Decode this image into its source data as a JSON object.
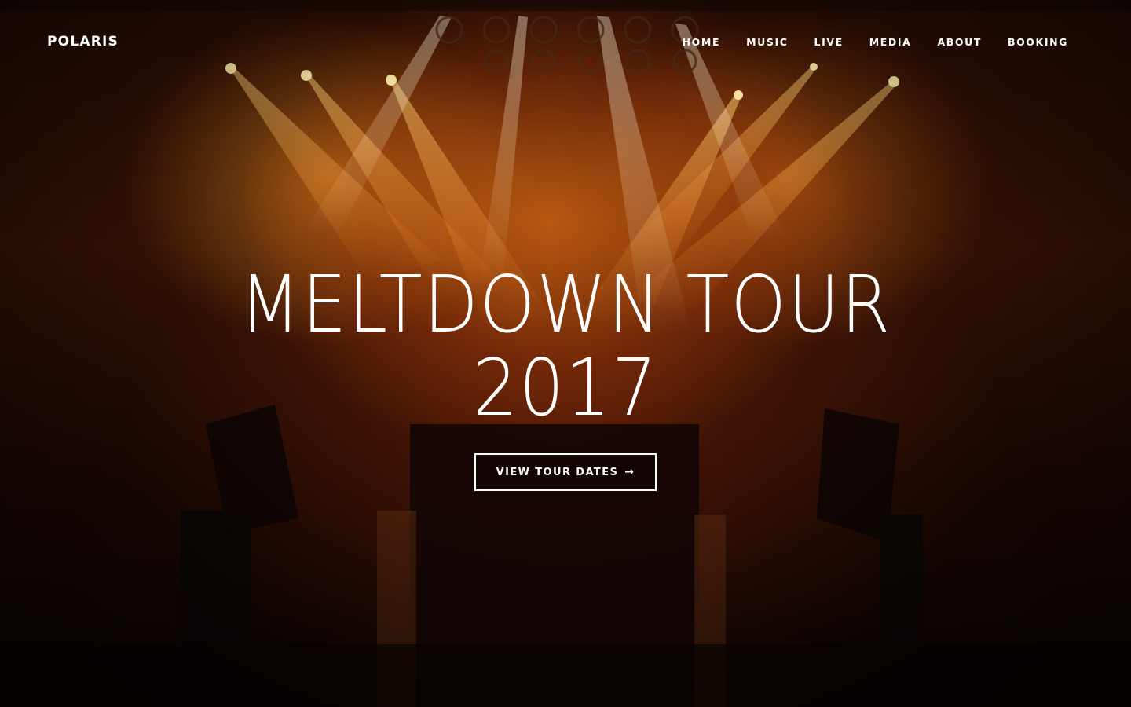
{
  "brand": {
    "name": "POLARIS"
  },
  "nav": {
    "items": [
      {
        "label": "HOME"
      },
      {
        "label": "MUSIC"
      },
      {
        "label": "LIVE"
      },
      {
        "label": "MEDIA"
      },
      {
        "label": "ABOUT"
      },
      {
        "label": "BOOKING"
      }
    ]
  },
  "hero": {
    "title_line1": "MELTDOWN TOUR",
    "title_line2": "2017",
    "cta_label": "VIEW TOUR DATES",
    "cta_arrow": "→"
  },
  "colors": {
    "text": "#ffffff",
    "accent_orange": "#ec7616",
    "background_dark": "#120703"
  },
  "icons": {
    "cta_icon": "arrow-right-icon"
  }
}
